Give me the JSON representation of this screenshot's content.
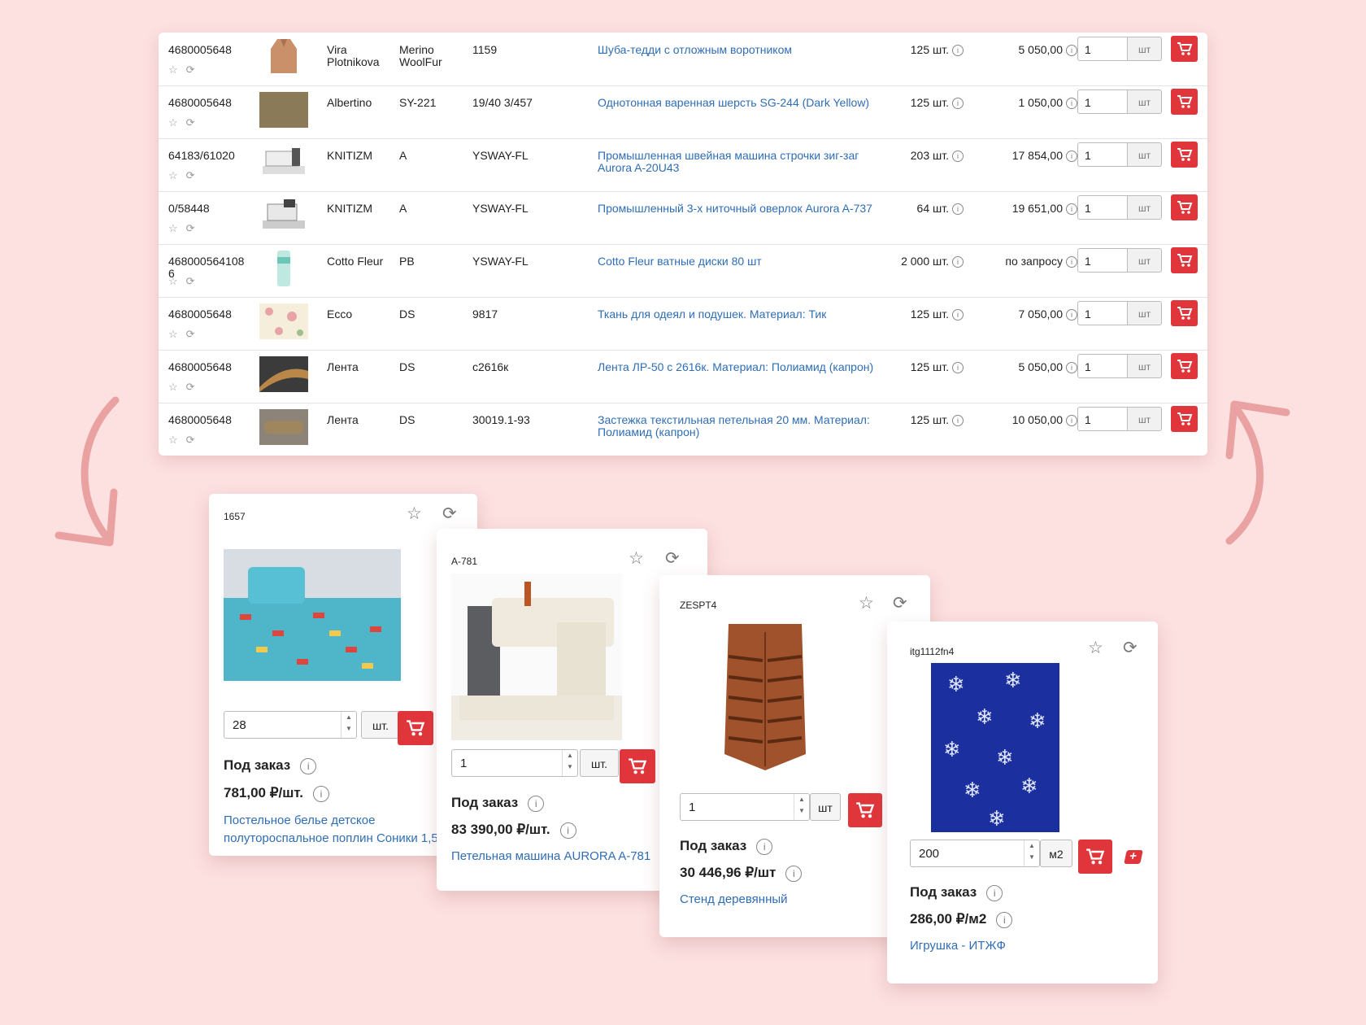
{
  "colors": {
    "background": "#fde0e0",
    "accent": "#e0353b",
    "link": "#2f6db5",
    "arrow": "#e9a1a1"
  },
  "icons": {
    "favorite": "star-icon",
    "compare": "compare-icon",
    "cart": "cart-icon",
    "info": "info-icon",
    "add": "add-to-cart-plus-icon"
  },
  "table": {
    "rows": [
      {
        "code": "4680005648",
        "image": "teddy-coat",
        "brand": "Vira Plotnikova",
        "collection": "Merino WoolFur",
        "article": "1159",
        "name": "Шуба-тедди с отложным воротником",
        "stock": "125 шт.",
        "price": "5 050,00",
        "qty": "1",
        "unit": "шт"
      },
      {
        "code": "4680005648",
        "image": "olive-fabric",
        "brand": "Albertino",
        "collection": "SY-221",
        "article": "19/40 3/457",
        "name": "Однотонная варенная шерсть SG-244 (Dark Yellow)",
        "stock": "125 шт.",
        "price": "1 050,00",
        "qty": "1",
        "unit": "шт"
      },
      {
        "code": "64183/61020",
        "image": "sewing-machine",
        "brand": "KNITIZM",
        "collection": "A",
        "article": "YSWAY-FL",
        "name": "Промышленная швейная машина строчки зиг-заг Aurora A-20U43",
        "stock": "203 шт.",
        "price": "17 854,00",
        "qty": "1",
        "unit": "шт"
      },
      {
        "code": "0/58448",
        "image": "overlock",
        "brand": "KNITIZM",
        "collection": "A",
        "article": "YSWAY-FL",
        "name": "Промышленный 3-х ниточный оверлок Aurora A-737",
        "stock": "64 шт.",
        "price": "19 651,00",
        "qty": "1",
        "unit": "шт"
      },
      {
        "code": "468000564108 6",
        "image": "cotton-pads",
        "brand": "Cotto Fleur",
        "collection": "PB",
        "article": "YSWAY-FL",
        "name": "Cotto Fleur ватные диски 80 шт",
        "stock": "2 000 шт.",
        "price": "по запросу",
        "qty": "1",
        "unit": "шт"
      },
      {
        "code": "4680005648",
        "image": "floral-fabric",
        "brand": "Ecco",
        "collection": "DS",
        "article": "9817",
        "name": "Ткань для одеял и подушек. Материал: Тик",
        "stock": "125 шт.",
        "price": "7 050,00",
        "qty": "1",
        "unit": "шт"
      },
      {
        "code": "4680005648",
        "image": "ribbon",
        "brand": "Лента",
        "collection": "DS",
        "article": "с2616к",
        "name": "Лента ЛР-50 с 2616к. Материал: Полиамид (капрон)",
        "stock": "125 шт.",
        "price": "5 050,00",
        "qty": "1",
        "unit": "шт"
      },
      {
        "code": "4680005648",
        "image": "loop-tape",
        "brand": "Лента",
        "collection": "DS",
        "article": "30019.1-93",
        "name": "Застежка текстильная петельная 20 мм. Материал: Полиамид (капрон)",
        "stock": "125 шт.",
        "price": "10 050,00",
        "qty": "1",
        "unit": "шт"
      }
    ]
  },
  "cards": [
    {
      "sku": "1657",
      "image": "bedding",
      "qty": "28",
      "unit": "шт.",
      "status": "Под заказ",
      "price": "781,00 ₽/шт.",
      "name": "Постельное белье детское полутороспальное поплин Соники 1,5"
    },
    {
      "sku": "A-781",
      "image": "buttonhole-machine",
      "qty": "1",
      "unit": "шт.",
      "status": "Под заказ",
      "price": "83 390,00 ₽/шт.",
      "name": "Петельная машина AURORA A-781"
    },
    {
      "sku": "ZESPT4",
      "image": "wooden-stand",
      "qty": "1",
      "unit": "шт",
      "status": "Под заказ",
      "price": "30 446,96 ₽/шт",
      "name": "Стенд деревянный"
    },
    {
      "sku": "itg1112fn4",
      "image": "snowflake-fabric",
      "qty": "200",
      "unit": "м2",
      "status": "Под заказ",
      "price": "286,00 ₽/м2",
      "name": "Игрушка - ИТЖФ"
    }
  ]
}
